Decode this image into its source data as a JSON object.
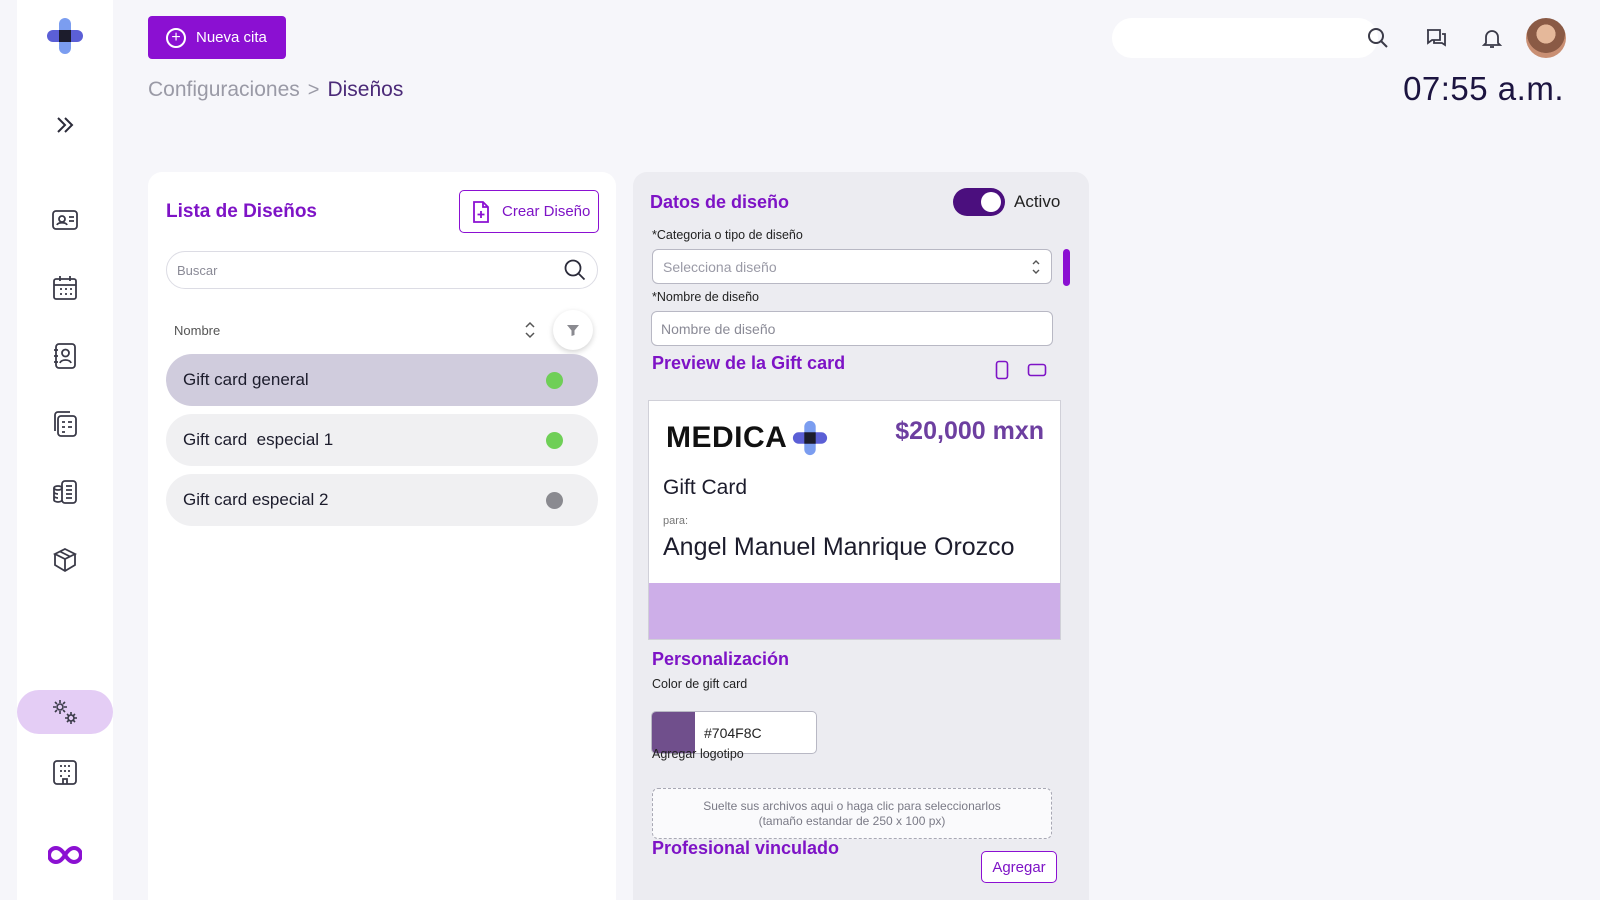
{
  "colors": {
    "accent": "#8b10d2",
    "title": "#7e13c6",
    "active_dot": "#6fcf57",
    "inactive_dot": "#8a8a90",
    "gift_color": "#704F8C",
    "gift_band": "#cdaee8"
  },
  "topbar": {
    "new_appointment_label": "Nueva cita",
    "breadcrumb": {
      "parent": "Configuraciones",
      "separator": ">",
      "current": "Diseños"
    },
    "clock": "07:55 a.m.",
    "icons": [
      "search-icon",
      "chat-icon",
      "bell-icon",
      "avatar"
    ]
  },
  "sidebar": {
    "items": [
      "logo-cross-icon",
      "expand-icon",
      "id-card-icon",
      "calendar-icon",
      "contact-book-icon",
      "documents-icon",
      "cash-icon",
      "box-icon",
      "settings-gears-icon",
      "building-icon",
      "brand-infinity-icon"
    ],
    "active": "settings-gears-icon"
  },
  "designs_list": {
    "title": "Lista de Diseños",
    "create_label": "Crear Diseño",
    "search_placeholder": "Buscar",
    "column_label": "Nombre",
    "items": [
      {
        "name": "Gift card general",
        "active": true,
        "selected": true
      },
      {
        "name": "Gift card  especial 1",
        "active": true,
        "selected": false
      },
      {
        "name": "Gift card especial 2",
        "active": false,
        "selected": false
      }
    ]
  },
  "design_data": {
    "title": "Datos de diseño",
    "toggle_label": "Activo",
    "toggle_on": true,
    "category_label": "*Categoria o tipo de diseño",
    "category_placeholder": "Selecciona diseño",
    "name_label": "*Nombre de diseño",
    "name_placeholder": "Nombre de diseño",
    "preview_title": "Preview de la Gift card",
    "gift_card": {
      "brand": "MEDICA",
      "amount": "$20,000 mxn",
      "type": "Gift Card",
      "for_label": "para:",
      "recipient": "Angel Manuel Manrique Orozco"
    },
    "personalization_title": "Personalización",
    "color_label": "Color de gift card",
    "color_value": "#704F8C",
    "logo_label": "Agregar logotipo",
    "dropzone_line1": "Suelte sus archivos aqui o haga clic para seleccionarlos",
    "dropzone_line2": "(tamaño estandar de 250 x 100 px)",
    "linked_title": "Profesional vinculado",
    "add_label": "Agregar"
  }
}
